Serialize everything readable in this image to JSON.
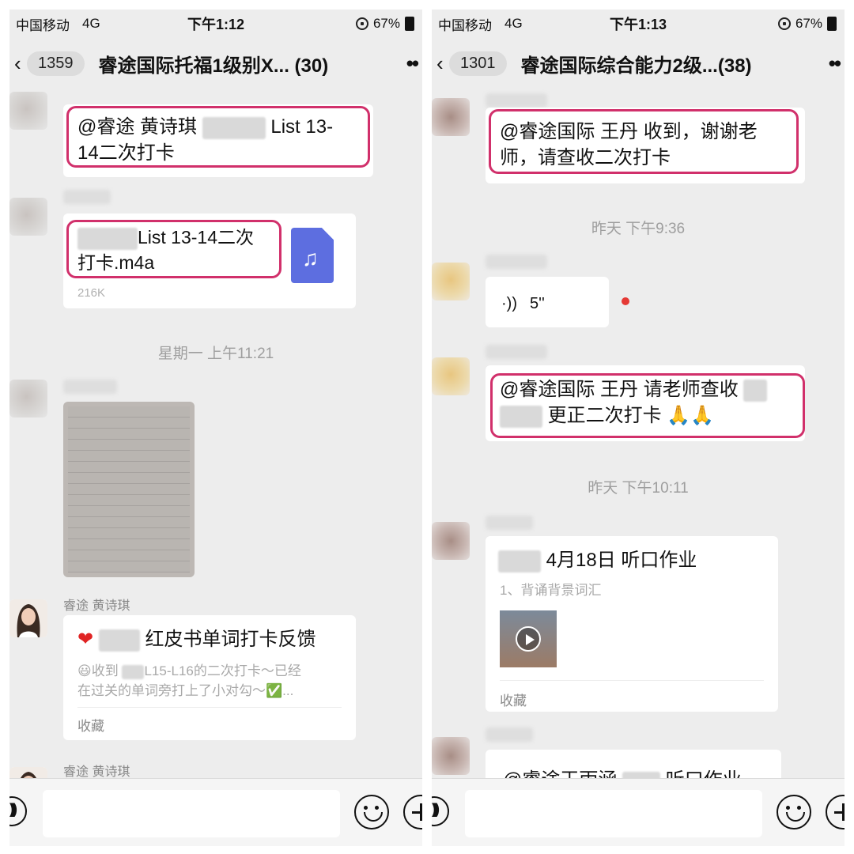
{
  "left": {
    "status": {
      "carrier": "中国移动",
      "network": "4G",
      "time": "下午1:12",
      "battery": "67%"
    },
    "nav": {
      "unread": "1359",
      "title": "睿途国际托福1级别X... (30)"
    },
    "messages": {
      "m1_text_a": "@睿途 黄诗琪",
      "m1_text_b": "List 13-",
      "m1_text_c": "14二次打卡",
      "file_line1": "List 13-14二次",
      "file_line2": "打卡.m4a",
      "file_size": "216K",
      "ts1": "星期一 上午11:21",
      "sender": "睿途 黄诗琪",
      "card_title": "红皮书单词打卡反馈",
      "card_desc_a": "收到",
      "card_desc_b": "L15-L16的二次打卡～已经",
      "card_desc_c": "在过关的单词旁打上了小对勾～",
      "card_source": "收藏",
      "sender2": "睿途 黄诗琪"
    }
  },
  "right": {
    "status": {
      "carrier": "中国移动",
      "network": "4G",
      "time": "下午1:13",
      "battery": "67%"
    },
    "nav": {
      "unread": "1301",
      "title": "睿途国际综合能力2级...(38)"
    },
    "messages": {
      "r1_line1": "@睿途国际 王丹 收到，谢谢老",
      "r1_line2": "师，请查收二次打卡",
      "ts1": "昨天 下午9:36",
      "voice_duration": "5''",
      "r2_line1": "@睿途国际 王丹 请老师查收",
      "r2_line2": "更正二次打卡",
      "ts2": "昨天 下午10:11",
      "card_title": "4月18日 听口作业",
      "card_desc": "1、背诵背景词汇",
      "card_source": "收藏",
      "r3_partial_a": "@睿途王雨涵",
      "r3_partial_b": "听口作业"
    }
  },
  "colors": {
    "highlight": "#d1306b",
    "chat_bg": "#ededed",
    "file_icon": "#5d6ee0",
    "unread_dot": "#e53935"
  },
  "icons": [
    "back-icon",
    "more-icon",
    "music-file-icon",
    "heart-icon",
    "smile-icon",
    "check-icon",
    "voice-icon",
    "play-icon",
    "emoji-icon",
    "plus-icon",
    "voice-toggle-icon",
    "lock-icon",
    "battery-icon",
    "pray-icon"
  ]
}
